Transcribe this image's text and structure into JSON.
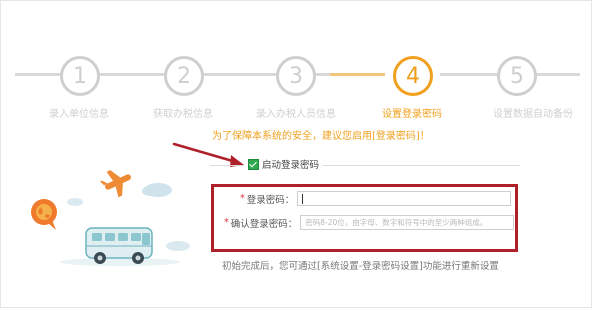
{
  "stepper": {
    "steps": [
      {
        "number": "1",
        "label": "录入单位信息",
        "state": "inactive"
      },
      {
        "number": "2",
        "label": "获取办税信息",
        "state": "inactive"
      },
      {
        "number": "3",
        "label": "录入办税人员信息",
        "state": "inactive"
      },
      {
        "number": "4",
        "label": "设置登录密码",
        "state": "active"
      },
      {
        "number": "5",
        "label": "设置数据自动备份",
        "state": "inactive"
      }
    ],
    "tip": "为了保障本系统的安全，建议您启用[登录密码]！"
  },
  "form": {
    "enable_label": "启动登录密码",
    "enable_checked": true,
    "password_label": "登录密码：",
    "password_value": "",
    "confirm_label": "确认登录密码：",
    "confirm_placeholder": "密码8-20位，由字母、数字和符号中的至少两种组成。",
    "required_mark": "*"
  },
  "note": "初始完成后，您可通过[系统设置-登录密码设置]功能进行重新设置",
  "colors": {
    "active": "#f0a01e",
    "inactive": "#cfcfcf",
    "highlight_box": "#b0202a",
    "arrow": "#b0202a",
    "checkbox": "#2fa84f"
  },
  "illustration": {
    "icons": [
      "globe-speech-bubble-icon",
      "airplane-icon",
      "cloud-icon",
      "bus-icon"
    ]
  }
}
